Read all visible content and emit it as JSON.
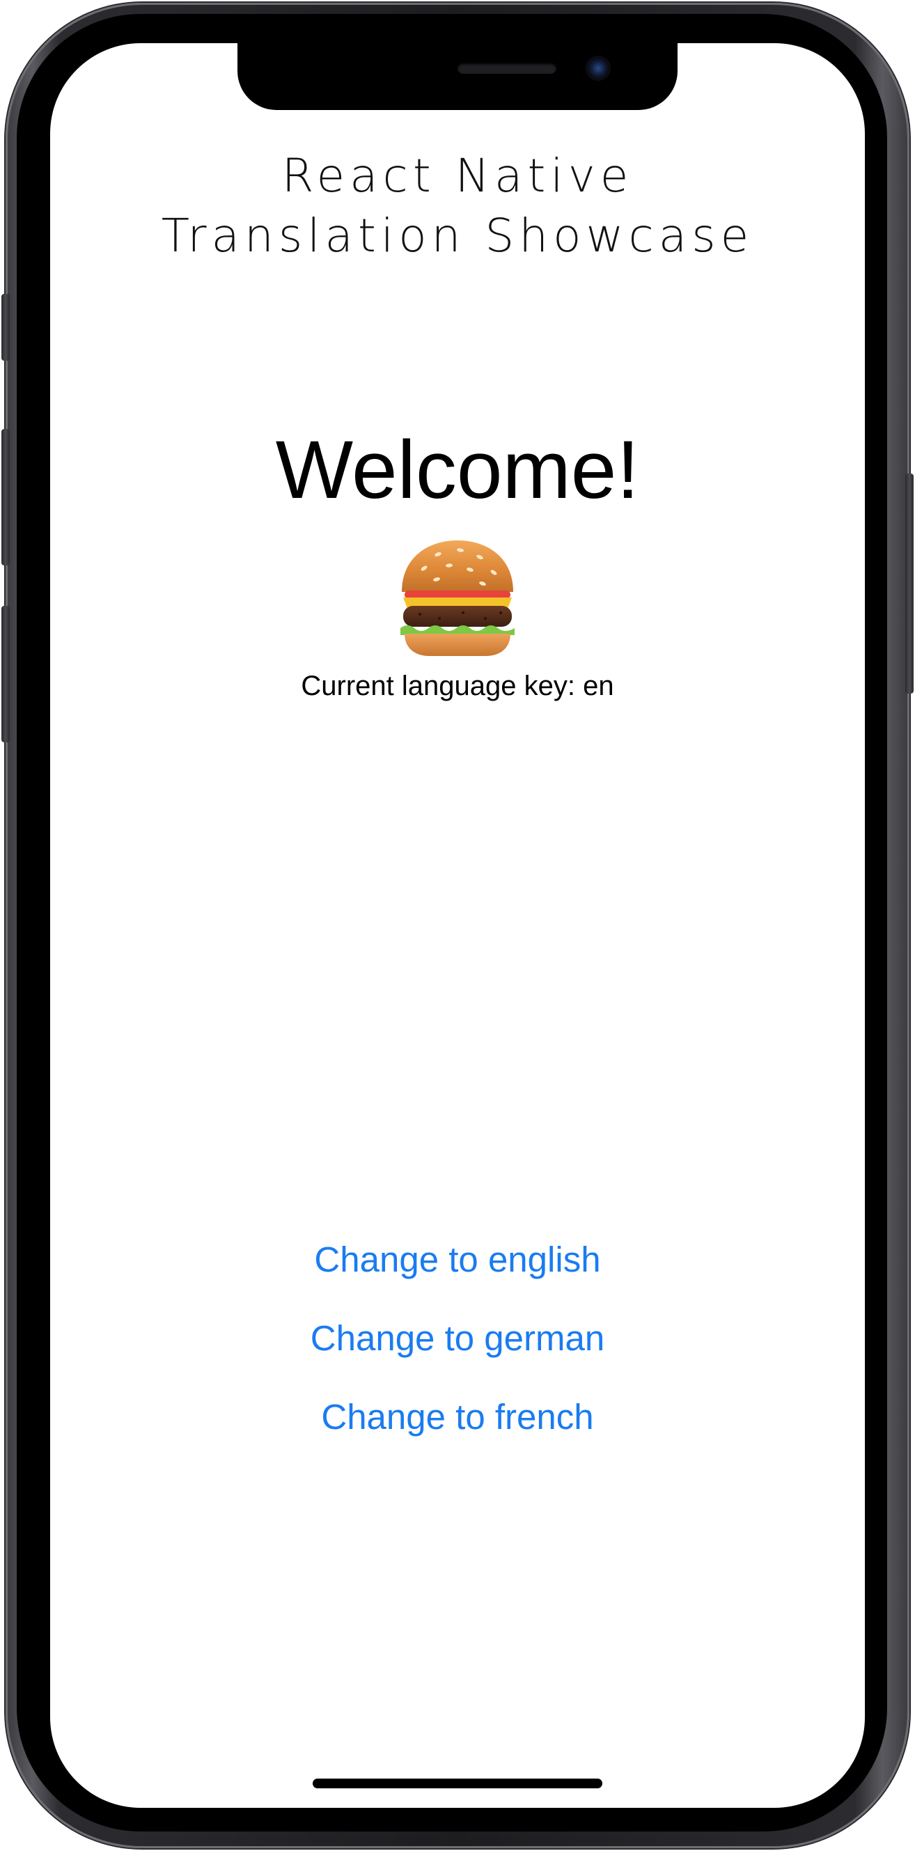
{
  "app": {
    "title_line1": "React Native",
    "title_line2": "Translation Showcase"
  },
  "main": {
    "welcome": "Welcome!",
    "emoji_icon": "hamburger-icon",
    "language_key_text": "Current language key: en"
  },
  "buttons": {
    "english": "Change to english",
    "german": "Change to german",
    "french": "Change to french"
  },
  "colors": {
    "link": "#1a7cf0",
    "text": "#000000",
    "background": "#ffffff"
  }
}
